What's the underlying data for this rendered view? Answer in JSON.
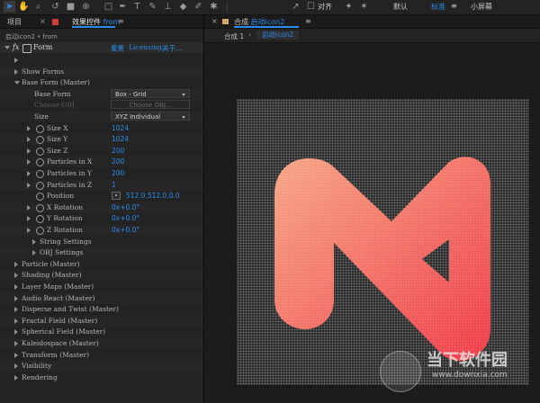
{
  "toolbar": {
    "align_label": "对齐",
    "workspaces": [
      "默认",
      "标准",
      "小屏幕"
    ],
    "active_workspace_index": 1,
    "menu_glyph": "≡"
  },
  "left_panel": {
    "tabs": [
      "项目",
      "效果控件"
    ],
    "active_layer": "from",
    "menu_glyph": "≡",
    "subheader": "启动icon2 • from",
    "effect": {
      "fx": "fx",
      "name": "Form",
      "links": [
        "重置",
        "Licensing...",
        "关于..."
      ]
    },
    "rows": [
      {
        "label": "",
        "twisty": "closed",
        "indent": 18
      },
      {
        "label": "Show Forms",
        "twisty": "closed",
        "indent": 18
      },
      {
        "label": "Base Form (Master)",
        "twisty": "open",
        "indent": 18
      },
      {
        "label": "Base Form",
        "indent": 38,
        "select": "Box - Grid"
      },
      {
        "label": "Choose OBJ",
        "indent": 38,
        "select": "Choose OBJ...",
        "dim": true
      },
      {
        "label": "Size",
        "indent": 38,
        "select": "XYZ Individual"
      },
      {
        "label": "Size X",
        "indent": 52,
        "twisty": "closed",
        "stopwatch": true,
        "value": "1024"
      },
      {
        "label": "Size Y",
        "indent": 52,
        "twisty": "closed",
        "stopwatch": true,
        "value": "1024"
      },
      {
        "label": "Size Z",
        "indent": 52,
        "twisty": "closed",
        "stopwatch": true,
        "value": "200"
      },
      {
        "label": "Particles in X",
        "indent": 52,
        "twisty": "closed",
        "stopwatch": true,
        "value": "200"
      },
      {
        "label": "Particles in Y",
        "indent": 52,
        "twisty": "closed",
        "stopwatch": true,
        "value": "200"
      },
      {
        "label": "Particles in Z",
        "indent": 52,
        "twisty": "closed",
        "stopwatch": true,
        "value": "1"
      },
      {
        "label": "Position",
        "indent": 52,
        "stopwatch": true,
        "value": "512.0,512.0,0.0",
        "point": true
      },
      {
        "label": "X Rotation",
        "indent": 52,
        "twisty": "closed",
        "stopwatch": true,
        "value": "0x+0.0°"
      },
      {
        "label": "Y Rotation",
        "indent": 52,
        "twisty": "closed",
        "stopwatch": true,
        "value": "0x+0.0°"
      },
      {
        "label": "Z Rotation",
        "indent": 52,
        "twisty": "closed",
        "stopwatch": true,
        "value": "0x+0.0°"
      },
      {
        "label": "String Settings",
        "indent": 38,
        "twisty": "closed"
      },
      {
        "label": "OBJ Settings",
        "indent": 38,
        "twisty": "closed"
      },
      {
        "label": "Particle (Master)",
        "indent": 18,
        "twisty": "closed"
      },
      {
        "label": "Shading (Master)",
        "indent": 18,
        "twisty": "closed"
      },
      {
        "label": "Layer Maps (Master)",
        "indent": 18,
        "twisty": "closed"
      },
      {
        "label": "Audio React (Master)",
        "indent": 18,
        "twisty": "closed"
      },
      {
        "label": "Disperse and Twist (Master)",
        "indent": 18,
        "twisty": "closed"
      },
      {
        "label": "Fractal Field (Master)",
        "indent": 18,
        "twisty": "closed"
      },
      {
        "label": "Spherical Field (Master)",
        "indent": 18,
        "twisty": "closed"
      },
      {
        "label": "Kaleidospace (Master)",
        "indent": 18,
        "twisty": "closed"
      },
      {
        "label": "Transform (Master)",
        "indent": 18,
        "twisty": "closed"
      },
      {
        "label": "Visibility",
        "indent": 18,
        "twisty": "closed"
      },
      {
        "label": "Rendering",
        "indent": 18,
        "twisty": "closed"
      }
    ]
  },
  "comp_panel": {
    "close": "×",
    "prefix": "合成",
    "comp_name": "启动icon2",
    "menu_glyph": "≡",
    "breadcrumb": [
      "合成 1",
      "启动icon2"
    ],
    "logo_gradient": [
      "#f7a787",
      "#ef3e4a"
    ]
  },
  "watermark": {
    "text": "当下软件园",
    "url": "www.downxia.com"
  }
}
